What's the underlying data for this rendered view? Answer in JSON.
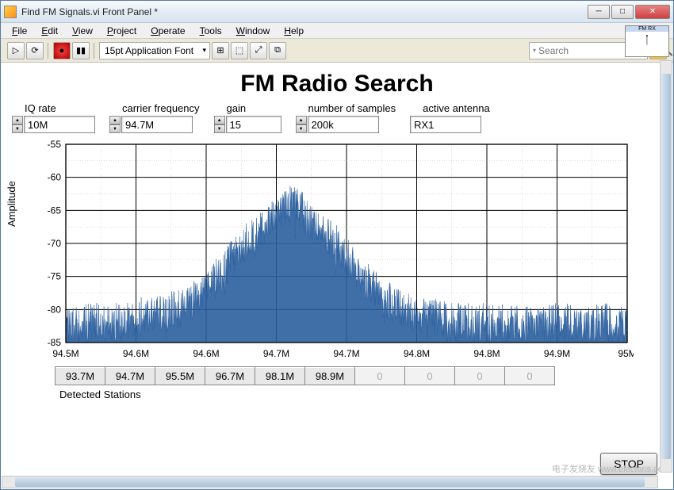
{
  "window": {
    "title": "Find FM Signals.vi Front Panel *"
  },
  "menu": [
    "File",
    "Edit",
    "View",
    "Project",
    "Operate",
    "Tools",
    "Window",
    "Help"
  ],
  "toolbar": {
    "font": "15pt Application Font",
    "search_placeholder": "Search"
  },
  "corner_badge": "FM RX",
  "heading": "FM Radio Search",
  "controls": {
    "iq_rate": {
      "label": "IQ rate",
      "value": "10M"
    },
    "carrier": {
      "label": "carrier frequency",
      "value": "94.7M"
    },
    "gain": {
      "label": "gain",
      "value": "15"
    },
    "samples": {
      "label": "number of samples",
      "value": "200k"
    },
    "antenna": {
      "label": "active antenna",
      "value": "RX1"
    }
  },
  "detected": {
    "label": "Detected Stations",
    "cells": [
      "93.7M",
      "94.7M",
      "95.5M",
      "96.7M",
      "98.1M",
      "98.9M",
      "0",
      "0",
      "0",
      "0"
    ]
  },
  "stop": "STOP",
  "chart_data": {
    "type": "line",
    "title": "",
    "ylabel": "Amplitude",
    "xlabel": "",
    "ylim": [
      -85,
      -55
    ],
    "xlim": [
      94.5,
      95.0
    ],
    "xticks": [
      "94.5M",
      "94.6M",
      "94.6M",
      "94.7M",
      "94.7M",
      "94.8M",
      "94.8M",
      "94.9M",
      "95M"
    ],
    "yticks": [
      -55,
      -60,
      -65,
      -70,
      -75,
      -80,
      -85
    ],
    "envelope": [
      {
        "x": 94.5,
        "y": -83
      },
      {
        "x": 94.52,
        "y": -82
      },
      {
        "x": 94.55,
        "y": -82
      },
      {
        "x": 94.57,
        "y": -81
      },
      {
        "x": 94.6,
        "y": -80
      },
      {
        "x": 94.62,
        "y": -78
      },
      {
        "x": 94.64,
        "y": -74
      },
      {
        "x": 94.66,
        "y": -70
      },
      {
        "x": 94.68,
        "y": -67
      },
      {
        "x": 94.69,
        "y": -65
      },
      {
        "x": 94.7,
        "y": -64
      },
      {
        "x": 94.71,
        "y": -65
      },
      {
        "x": 94.72,
        "y": -67
      },
      {
        "x": 94.74,
        "y": -70
      },
      {
        "x": 94.76,
        "y": -74
      },
      {
        "x": 94.78,
        "y": -78
      },
      {
        "x": 94.8,
        "y": -80
      },
      {
        "x": 94.82,
        "y": -81
      },
      {
        "x": 94.85,
        "y": -82
      },
      {
        "x": 94.88,
        "y": -82
      },
      {
        "x": 94.92,
        "y": -82
      },
      {
        "x": 94.98,
        "y": -82
      },
      {
        "x": 95.0,
        "y": -82
      }
    ],
    "noise_floor": -85,
    "noise_spread_db": 3,
    "samples_drawn": 1400
  },
  "watermark": "电子发烧友\nwww.elecfans.com"
}
